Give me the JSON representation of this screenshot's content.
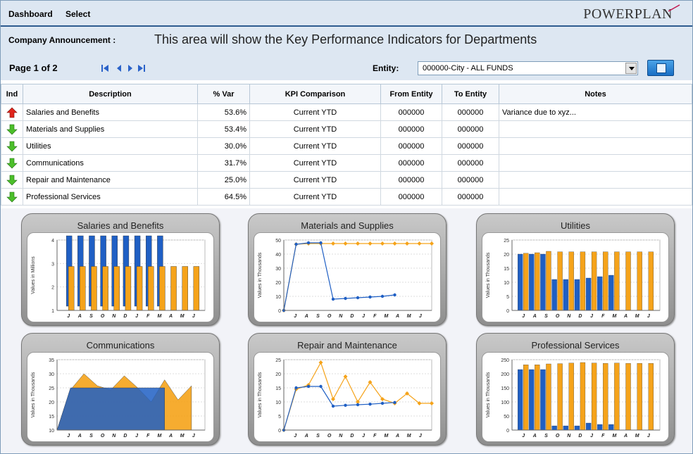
{
  "menu": {
    "dashboard": "Dashboard",
    "select": "Select"
  },
  "logo": "POWERPLAN",
  "announcement": {
    "label": "Company Announcement :",
    "text": "This area will show the Key Performance Indicators for Departments"
  },
  "pager": {
    "text": "Page  1  of  2"
  },
  "entity": {
    "label": "Entity:",
    "value": "000000-City - ALL FUNDS"
  },
  "table": {
    "headers": [
      "Ind",
      "Description",
      "% Var",
      "KPI Comparison",
      "From Entity",
      "To Entity",
      "Notes"
    ],
    "rows": [
      {
        "ind": "up",
        "description": "Salaries and Benefits",
        "var": "53.6%",
        "kpi": "Current YTD",
        "from": "000000",
        "to": "000000",
        "notes": "Variance due to xyz..."
      },
      {
        "ind": "down",
        "description": "Materials and Supplies",
        "var": "53.4%",
        "kpi": "Current YTD",
        "from": "000000",
        "to": "000000",
        "notes": ""
      },
      {
        "ind": "down",
        "description": "Utilities",
        "var": "30.0%",
        "kpi": "Current YTD",
        "from": "000000",
        "to": "000000",
        "notes": ""
      },
      {
        "ind": "down",
        "description": "Communications",
        "var": "31.7%",
        "kpi": "Current YTD",
        "from": "000000",
        "to": "000000",
        "notes": ""
      },
      {
        "ind": "down",
        "description": "Repair and Maintenance",
        "var": "25.0%",
        "kpi": "Current YTD",
        "from": "000000",
        "to": "000000",
        "notes": ""
      },
      {
        "ind": "down",
        "description": "Professional Services",
        "var": "64.5%",
        "kpi": "Current YTD",
        "from": "000000",
        "to": "000000",
        "notes": ""
      }
    ]
  },
  "colors": {
    "actual": "#1f5fc4",
    "budget": "#f5a31a",
    "up": "#e0241b",
    "down": "#4cbf2a"
  },
  "chart_data": [
    {
      "title": "Salaries and Benefits",
      "type": "bar",
      "style": "3d",
      "ylabel": "Values in Millions",
      "ylim": [
        0,
        4
      ],
      "yticks": [
        "1",
        "2",
        "3",
        "4"
      ],
      "categories": [
        "J",
        "A",
        "S",
        "O",
        "N",
        "D",
        "J",
        "F",
        "M",
        "A",
        "M",
        "J"
      ],
      "series": [
        {
          "values": [
            4.2,
            4.2,
            4.2,
            4.2,
            4.2,
            4.2,
            4.2,
            4.2,
            4.2,
            null,
            null,
            null
          ]
        },
        {
          "values": [
            2.5,
            2.5,
            2.5,
            2.5,
            2.5,
            2.5,
            2.5,
            2.5,
            2.5,
            2.5,
            2.5,
            2.5
          ]
        }
      ]
    },
    {
      "title": "Materials and Supplies",
      "type": "line",
      "ylabel": "Values in Thousands",
      "ylim": [
        0,
        50
      ],
      "yticks": [
        "0",
        "10",
        "20",
        "30",
        "40",
        "50"
      ],
      "categories": [
        "J",
        "A",
        "S",
        "O",
        "N",
        "D",
        "J",
        "F",
        "M",
        "A",
        "M",
        "J"
      ],
      "series": [
        {
          "values": [
            0,
            47,
            48,
            48,
            8,
            8.5,
            9,
            9.5,
            10,
            11,
            null,
            null,
            null
          ]
        },
        {
          "values": [
            0,
            47,
            47.5,
            47.5,
            47.5,
            47.5,
            47.5,
            47.5,
            47.5,
            47.5,
            47.5,
            47.5,
            47.5
          ]
        }
      ]
    },
    {
      "title": "Utilities",
      "type": "bar",
      "ylabel": "Values in Thousands",
      "ylim": [
        0,
        25
      ],
      "yticks": [
        "0",
        "5",
        "10",
        "15",
        "20",
        "25"
      ],
      "categories": [
        "J",
        "A",
        "S",
        "O",
        "N",
        "D",
        "J",
        "F",
        "M",
        "A",
        "M",
        "J"
      ],
      "series": [
        {
          "values": [
            20,
            20,
            20,
            11,
            11,
            11,
            11.5,
            12,
            12.5,
            null,
            null,
            null
          ]
        },
        {
          "values": [
            20.3,
            20.5,
            21,
            20.8,
            20.8,
            20.8,
            20.8,
            20.8,
            20.8,
            20.8,
            20.8,
            20.8
          ]
        }
      ]
    },
    {
      "title": "Communications",
      "type": "area",
      "style": "3d",
      "ylabel": "Values in Thousands",
      "ylim": [
        0,
        35
      ],
      "yticks": [
        "10",
        "15",
        "20",
        "25",
        "30",
        "35"
      ],
      "categories": [
        "J",
        "A",
        "S",
        "O",
        "N",
        "D",
        "J",
        "F",
        "M",
        "A",
        "M",
        "J"
      ],
      "series": [
        {
          "values": [
            0,
            21,
            21,
            21,
            21,
            21,
            21,
            21,
            21,
            null,
            null,
            null
          ]
        },
        {
          "values": [
            0,
            20,
            28,
            22,
            20,
            27,
            21,
            14,
            25,
            15,
            22,
            null
          ]
        }
      ]
    },
    {
      "title": "Repair and Maintenance",
      "type": "line",
      "ylabel": "Values in Thousands",
      "ylim": [
        0,
        25
      ],
      "yticks": [
        "0",
        "5",
        "10",
        "15",
        "20",
        "25"
      ],
      "categories": [
        "J",
        "A",
        "S",
        "O",
        "N",
        "D",
        "J",
        "F",
        "M",
        "A",
        "M",
        "J"
      ],
      "series": [
        {
          "values": [
            0,
            15,
            15.5,
            15.5,
            8.5,
            8.8,
            9,
            9.2,
            9.5,
            9.8,
            null,
            null,
            null
          ]
        },
        {
          "values": [
            0,
            14.5,
            16,
            24,
            11,
            19,
            10,
            17,
            11,
            9.5,
            13,
            9.5,
            9.5
          ]
        }
      ]
    },
    {
      "title": "Professional Services",
      "type": "bar",
      "ylabel": "Values in Thousands",
      "ylim": [
        0,
        250
      ],
      "yticks": [
        "0",
        "50",
        "100",
        "150",
        "200",
        "250"
      ],
      "categories": [
        "J",
        "A",
        "S",
        "O",
        "N",
        "D",
        "J",
        "F",
        "M",
        "A",
        "M",
        "J"
      ],
      "series": [
        {
          "values": [
            215,
            215,
            215,
            15,
            15,
            15,
            25,
            20,
            20,
            null,
            null,
            null
          ]
        },
        {
          "values": [
            232,
            232,
            235,
            236,
            238,
            240,
            238,
            237,
            238,
            237,
            237,
            237
          ]
        }
      ]
    }
  ]
}
